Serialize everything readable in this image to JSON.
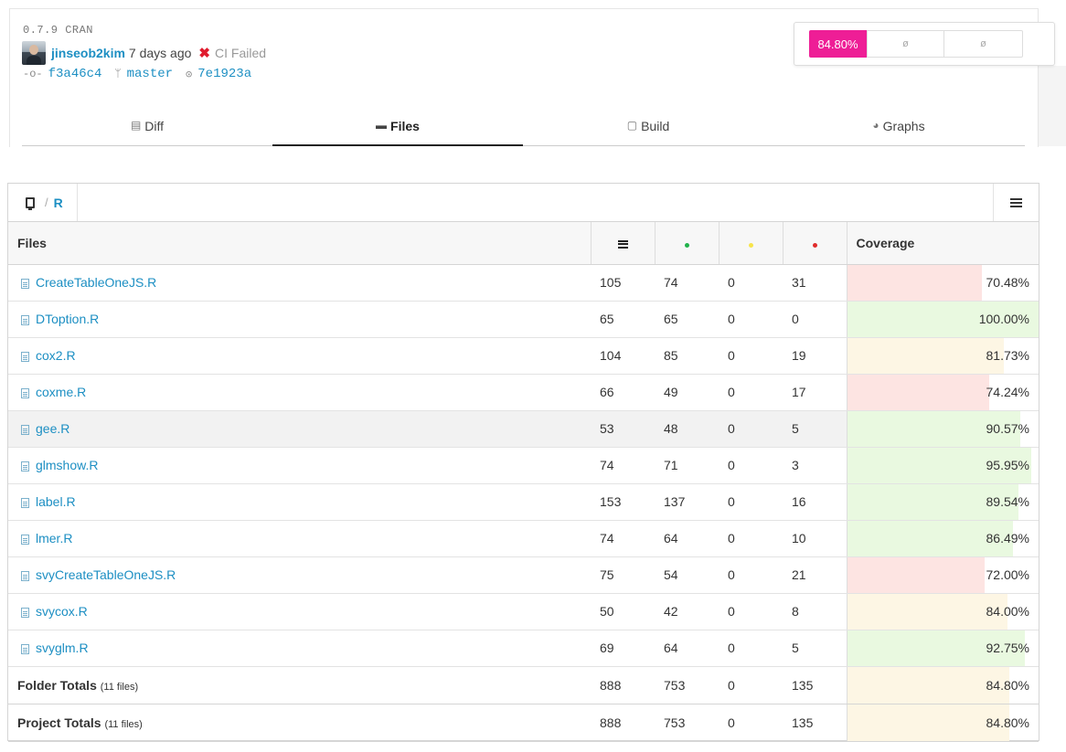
{
  "header": {
    "version": "0.7.9 CRAN",
    "author": "jinseob2kim",
    "ago": "7 days ago",
    "ci_icon": "✖",
    "ci_status": "CI Failed",
    "commit": "f3a46c4",
    "branch": "master",
    "parent": "7e1923a",
    "coverage_badge": "84.80%",
    "badge_empty_1": "ø",
    "badge_empty_2": "ø",
    "badge_color": "#ee1e96"
  },
  "tabs": [
    {
      "label": "Diff",
      "icon": "diff-icon"
    },
    {
      "label": "Files",
      "icon": "folder-icon"
    },
    {
      "label": "Build",
      "icon": "build-icon"
    },
    {
      "label": "Graphs",
      "icon": "pie-chart-icon"
    }
  ],
  "breadcrumb": {
    "sep": "/",
    "dir": "R"
  },
  "table": {
    "header": {
      "files": "Files",
      "coverage": "Coverage"
    },
    "colors": {
      "hit": "#21b24b",
      "partial": "#f7e44a",
      "miss": "#e02c2c",
      "low": "#fde4e2",
      "mid": "#fdf6e4",
      "high": "#e9f9e0"
    },
    "rows": [
      {
        "file": "CreateTableOneJS.R",
        "lines": "105",
        "hit": "74",
        "partial": "0",
        "miss": "31",
        "coverage": "70.48%",
        "cov_value": 70.48
      },
      {
        "file": "DToption.R",
        "lines": "65",
        "hit": "65",
        "partial": "0",
        "miss": "0",
        "coverage": "100.00%",
        "cov_value": 100.0
      },
      {
        "file": "cox2.R",
        "lines": "104",
        "hit": "85",
        "partial": "0",
        "miss": "19",
        "coverage": "81.73%",
        "cov_value": 81.73
      },
      {
        "file": "coxme.R",
        "lines": "66",
        "hit": "49",
        "partial": "0",
        "miss": "17",
        "coverage": "74.24%",
        "cov_value": 74.24
      },
      {
        "file": "gee.R",
        "lines": "53",
        "hit": "48",
        "partial": "0",
        "miss": "5",
        "coverage": "90.57%",
        "cov_value": 90.57
      },
      {
        "file": "glmshow.R",
        "lines": "74",
        "hit": "71",
        "partial": "0",
        "miss": "3",
        "coverage": "95.95%",
        "cov_value": 95.95
      },
      {
        "file": "label.R",
        "lines": "153",
        "hit": "137",
        "partial": "0",
        "miss": "16",
        "coverage": "89.54%",
        "cov_value": 89.54
      },
      {
        "file": "lmer.R",
        "lines": "74",
        "hit": "64",
        "partial": "0",
        "miss": "10",
        "coverage": "86.49%",
        "cov_value": 86.49
      },
      {
        "file": "svyCreateTableOneJS.R",
        "lines": "75",
        "hit": "54",
        "partial": "0",
        "miss": "21",
        "coverage": "72.00%",
        "cov_value": 72.0
      },
      {
        "file": "svycox.R",
        "lines": "50",
        "hit": "42",
        "partial": "0",
        "miss": "8",
        "coverage": "84.00%",
        "cov_value": 84.0
      },
      {
        "file": "svyglm.R",
        "lines": "69",
        "hit": "64",
        "partial": "0",
        "miss": "5",
        "coverage": "92.75%",
        "cov_value": 92.75
      }
    ],
    "folder_totals": {
      "label": "Folder Totals",
      "note": "(11 files)",
      "lines": "888",
      "hit": "753",
      "partial": "0",
      "miss": "135",
      "coverage": "84.80%",
      "cov_value": 84.8
    },
    "project_totals": {
      "label": "Project Totals",
      "note": "(11 files)",
      "lines": "888",
      "hit": "753",
      "partial": "0",
      "miss": "135",
      "coverage": "84.80%",
      "cov_value": 84.8
    }
  }
}
